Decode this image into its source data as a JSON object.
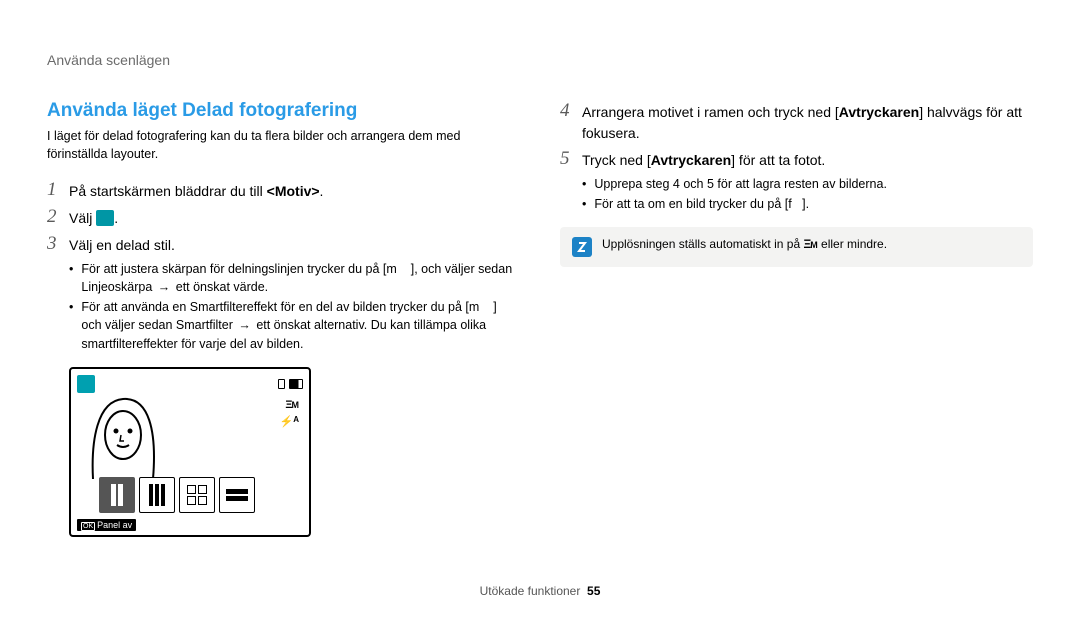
{
  "header": {
    "section": "Använda scenlägen"
  },
  "left": {
    "title": "Använda läget Delad fotografering",
    "intro": "I läget för delad fotografering kan du ta flera bilder och arrangera dem med förinställda layouter.",
    "steps": {
      "s1": {
        "num": "1",
        "text_pre": "På startskärmen bläddrar du till ",
        "text_bold": "<Motiv>",
        "text_post": "."
      },
      "s2": {
        "num": "2",
        "text": "Välj "
      },
      "s3": {
        "num": "3",
        "text": "Välj en delad stil."
      }
    },
    "bullets": {
      "b1_pre": "För att justera skärpan för delningslinjen trycker du på [",
      "b1_mid": "], och väljer sedan ",
      "b1_bold": "Linjeoskärpa",
      "b1_arrow": "→",
      "b1_post": " ett önskat värde.",
      "b2_pre": "För att använda en Smartfiltereffekt för en del av bilden trycker du på [",
      "b2_mid": "] och väljer sedan ",
      "b2_bold": "Smartfilter",
      "b2_arrow": "→",
      "b2_post": " ett önskat alternativ. Du kan tillämpa olika smartfiltereffekter för varje del av bilden."
    },
    "screenshot": {
      "ok_label": "OK",
      "label_text": "Panel av",
      "m_label": "M",
      "flash_label": "A"
    }
  },
  "right": {
    "steps": {
      "s4": {
        "num": "4",
        "pre": "Arrangera motivet i ramen och tryck ned [",
        "bold": "Avtryckaren",
        "post": "] halvvägs för att fokusera."
      },
      "s5": {
        "num": "5",
        "pre": "Tryck ned [",
        "bold": "Avtryckaren",
        "post": "] för att ta fotot."
      }
    },
    "bullets": {
      "b1": "Upprepa steg 4 och 5 för att lagra resten av bilderna.",
      "b2_pre": "För att ta om en bild trycker du på [",
      "b2_post": "]."
    },
    "info": "Upplösningen ställs automatiskt in på       eller mindre."
  },
  "footer": {
    "text": "Utökade funktioner",
    "page": "55"
  }
}
